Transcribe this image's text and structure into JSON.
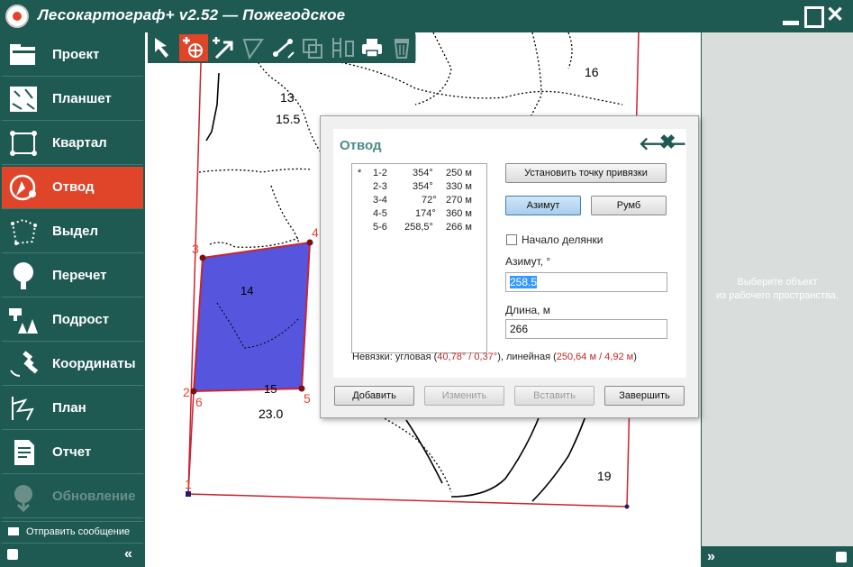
{
  "app": {
    "title": "Лесокартограф+ v2.52 — Пожегодское"
  },
  "sidebar": {
    "items": [
      {
        "label": "Проект",
        "icon": "folder-icon",
        "state": "normal"
      },
      {
        "label": "Планшет",
        "icon": "map-sheet-icon",
        "state": "normal"
      },
      {
        "label": "Квартал",
        "icon": "quarter-icon",
        "state": "normal"
      },
      {
        "label": "Отвод",
        "icon": "compass-icon",
        "state": "active"
      },
      {
        "label": "Выдел",
        "icon": "polygon-icon",
        "state": "normal"
      },
      {
        "label": "Перечет",
        "icon": "tree-icon",
        "state": "normal"
      },
      {
        "label": "Подрост",
        "icon": "saplings-icon",
        "state": "normal"
      },
      {
        "label": "Координаты",
        "icon": "satellite-icon",
        "state": "normal"
      },
      {
        "label": "План",
        "icon": "plan-icon",
        "state": "normal"
      },
      {
        "label": "Отчет",
        "icon": "report-icon",
        "state": "normal"
      },
      {
        "label": "Обновление",
        "icon": "update-icon",
        "state": "disabled"
      }
    ],
    "send_message": "Отправить сообщение"
  },
  "toolbar": {
    "tools": [
      {
        "name": "select-tool",
        "icon": "arrow-cursor-icon",
        "state": "normal"
      },
      {
        "name": "add-point-tool",
        "icon": "add-point-icon",
        "state": "active"
      },
      {
        "name": "add-direction-tool",
        "icon": "add-arrow-icon",
        "state": "normal"
      },
      {
        "name": "angle-tool",
        "icon": "angle-icon",
        "state": "disabled"
      },
      {
        "name": "measure-tool",
        "icon": "measure-icon",
        "state": "normal"
      },
      {
        "name": "copy-tool",
        "icon": "copy-icon",
        "state": "disabled"
      },
      {
        "name": "parcel-tool",
        "icon": "parcel-icon",
        "state": "disabled"
      },
      {
        "name": "print-tool",
        "icon": "print-icon",
        "state": "normal"
      },
      {
        "name": "delete-tool",
        "icon": "trash-icon",
        "state": "disabled"
      }
    ]
  },
  "map": {
    "labels": {
      "l13": "13",
      "l155": "15.5",
      "l16": "16",
      "l14": "14",
      "l15": "15",
      "l230": "23.0",
      "l19": "19"
    },
    "vertices": {
      "v1": "1",
      "v2": "2",
      "v3": "3",
      "v4": "4",
      "v5": "5",
      "v6": "6"
    },
    "colors": {
      "parcel_fill": "#5555dd",
      "parcel_stroke": "#cc2233",
      "boundary": "#cc2233"
    }
  },
  "right_panel": {
    "hint_line1": "Выберите объект",
    "hint_line2": "из рабочего пространства."
  },
  "dialog": {
    "title": "Отвод",
    "segments": [
      {
        "marker": "*",
        "id": "1-2",
        "azimuth": "354°",
        "length": "250 м"
      },
      {
        "marker": "",
        "id": "2-3",
        "azimuth": "354°",
        "length": "330 м"
      },
      {
        "marker": "",
        "id": "3-4",
        "azimuth": "72°",
        "length": "270 м"
      },
      {
        "marker": "",
        "id": "4-5",
        "azimuth": "174°",
        "length": "360 м"
      },
      {
        "marker": "",
        "id": "5-6",
        "azimuth": "258,5°",
        "length": "266 м"
      }
    ],
    "set_anchor_button": "Установить точку привязки",
    "azimuth_button": "Азимут",
    "rumb_button": "Румб",
    "start_parcel_label": "Начало делянки",
    "start_parcel_checked": false,
    "azimuth_label": "Азимут, °",
    "azimuth_value": "258.5",
    "length_label": "Длина, м",
    "length_value": "266",
    "closure": {
      "prefix": "Невязки: угловая (",
      "angular": "40,78° / 0,37°",
      "middle": "), линейная (",
      "linear": "250,64 м / 4,92 м",
      "suffix": ")"
    },
    "add_button": "Добавить",
    "edit_button": "Изменить",
    "insert_button": "Вставить",
    "finish_button": "Завершить"
  }
}
